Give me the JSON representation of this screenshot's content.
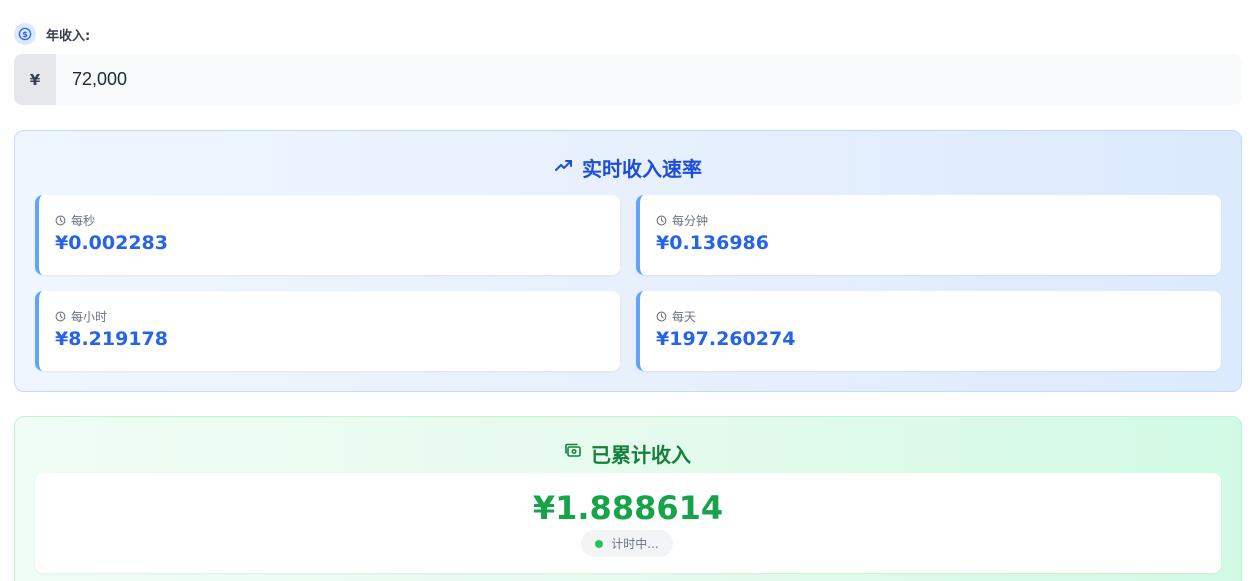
{
  "income": {
    "label": "年收入:",
    "currency_symbol": "¥",
    "value": "72,000"
  },
  "rate_panel": {
    "title": "实时收入速率",
    "cards": [
      {
        "label": "每秒",
        "value": "¥0.002283"
      },
      {
        "label": "每分钟",
        "value": "¥0.136986"
      },
      {
        "label": "每小时",
        "value": "¥8.219178"
      },
      {
        "label": "每天",
        "value": "¥197.260274"
      }
    ]
  },
  "accumulated": {
    "title": "已累计收入",
    "value": "¥1.888614",
    "status": "计时中..."
  },
  "icons": {
    "coin": "coin-icon",
    "trend": "trending-up-icon",
    "clock": "clock-icon",
    "cash": "cash-icon"
  },
  "colors": {
    "rate_accent": "#2563eb",
    "rate_title": "#1d4ed8",
    "accum_accent": "#16a34a",
    "accum_title": "#15803d",
    "status_dot": "#22c55e"
  }
}
